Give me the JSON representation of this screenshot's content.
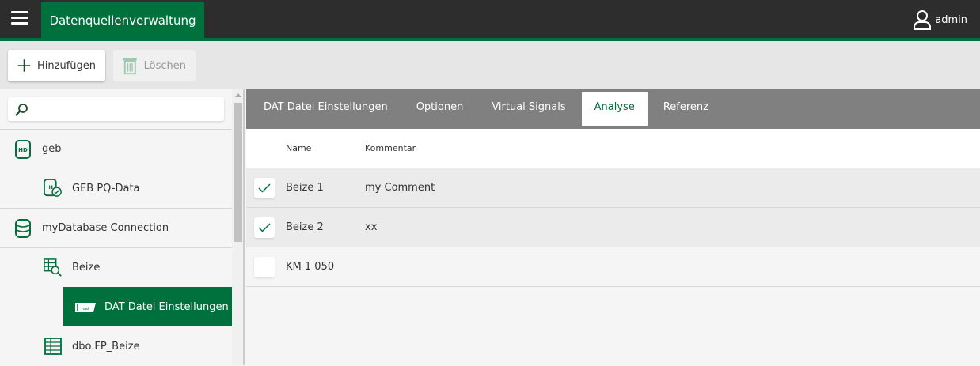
{
  "header": {
    "app_title": "Datenquellenverwaltung",
    "user": "admin"
  },
  "toolbar": {
    "add_label": "Hinzufügen",
    "delete_label": "Löschen"
  },
  "search": {
    "placeholder": ""
  },
  "tree": [
    {
      "label": "geb",
      "icon": "hd-database-icon",
      "level": 0
    },
    {
      "label": "GEB PQ-Data",
      "icon": "hd-clock-database-icon",
      "level": 1
    },
    {
      "label": "myDatabase Connection",
      "icon": "database-icon",
      "level": 0
    },
    {
      "label": "Beize",
      "icon": "table-search-icon",
      "level": 1
    },
    {
      "label": "DAT Datei Einstellungen",
      "icon": "dat-file-icon",
      "level": 2,
      "selected": true
    },
    {
      "label": "dbo.FP_Beize",
      "icon": "table-icon",
      "level": 1
    }
  ],
  "tabs": [
    "DAT Datei Einstellungen",
    "Optionen",
    "Virtual Signals",
    "Analyse",
    "Referenz"
  ],
  "active_tab": "Analyse",
  "table": {
    "columns": [
      "Name",
      "Kommentar"
    ],
    "rows": [
      {
        "checked": true,
        "name": "Beize 1",
        "comment": "my Comment"
      },
      {
        "checked": true,
        "name": "Beize 2",
        "comment": "xx"
      },
      {
        "checked": false,
        "name": "KM 1 050",
        "comment": ""
      }
    ]
  },
  "colors": {
    "brand": "#00703c",
    "topbar": "#2d2d2d",
    "tabbar": "#808080"
  }
}
